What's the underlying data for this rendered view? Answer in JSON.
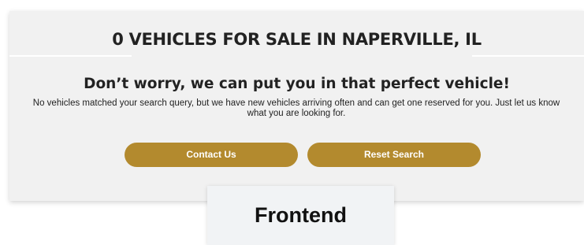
{
  "results": {
    "headline": "0 VEHICLES FOR SALE IN NAPERVILLE, IL",
    "subheadline": "Don’t worry, we can put you in that perfect vehicle!",
    "message": "No vehicles matched your search query, but we have new vehicles arriving often and can get one reserved for you. Just let us know what you are looking for."
  },
  "actions": {
    "contact_label": "Contact Us",
    "reset_label": "Reset Search"
  },
  "badge": {
    "label": "Frontend"
  },
  "colors": {
    "button": "#b38a2e",
    "panel": "#f1f1f1",
    "badge": "#f1f3f5"
  }
}
